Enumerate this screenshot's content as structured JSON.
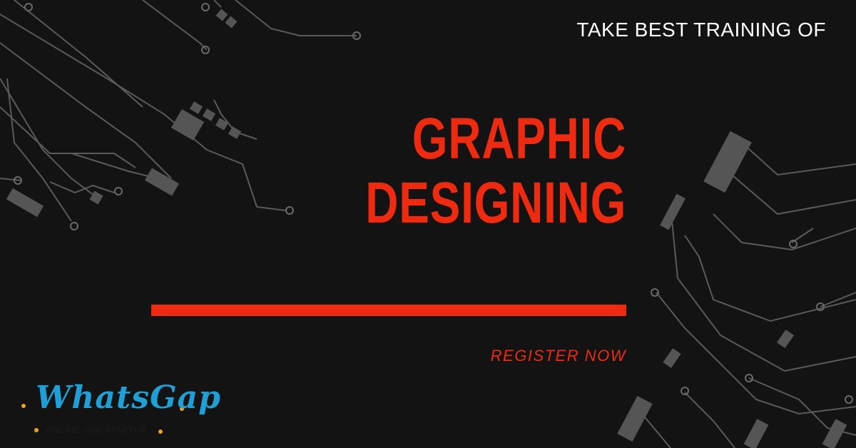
{
  "banner": {
    "tagline": "TAKE BEST TRAINING OF",
    "headline_line1": "GRAPHIC",
    "headline_line2": "DESIGNING",
    "cta": "REGISTER NOW"
  },
  "logo": {
    "name": "WhatsGap",
    "tagline": "ONLINE JOB STARTUP"
  },
  "colors": {
    "background": "#131313",
    "accent": "#ee2a11",
    "text": "#ffffff",
    "circuit": "#5a5a5a",
    "logo_blue": "#1e9fd6",
    "logo_dots": "#f0a020"
  }
}
